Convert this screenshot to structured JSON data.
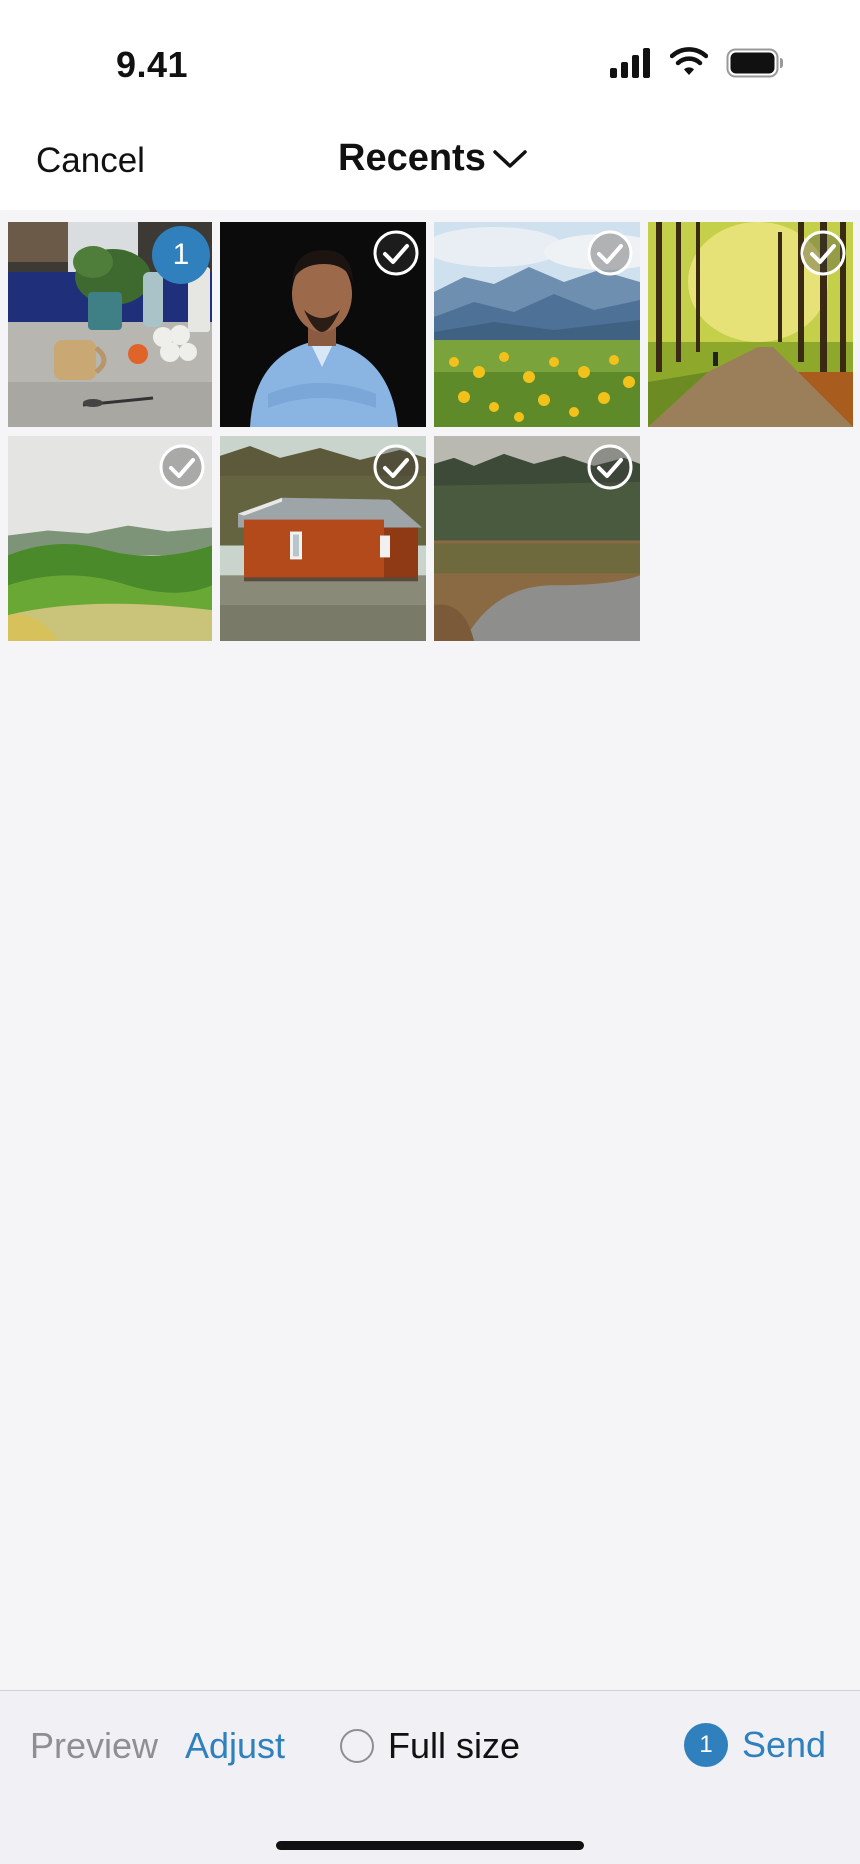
{
  "status_bar": {
    "time": "9.41",
    "icons": [
      "signal-icon",
      "wifi-icon",
      "battery-icon"
    ]
  },
  "nav": {
    "cancel_label": "Cancel",
    "album_title": "Recents",
    "album_icon": "chevron-down-icon"
  },
  "photos": [
    {
      "name": "kitchen-plant-mug",
      "selected": true,
      "selection_number": "1"
    },
    {
      "name": "man-portrait",
      "selected": false
    },
    {
      "name": "mountain-wildflowers",
      "selected": false
    },
    {
      "name": "forest-path",
      "selected": false
    },
    {
      "name": "green-hills",
      "selected": false
    },
    {
      "name": "red-cabin",
      "selected": false
    },
    {
      "name": "forest-lake",
      "selected": false
    }
  ],
  "toolbar": {
    "preview_label": "Preview",
    "adjust_label": "Adjust",
    "fullsize_label": "Full size",
    "fullsize_checked": false,
    "send_count": "1",
    "send_label": "Send"
  },
  "colors": {
    "accent": "#2f80bd",
    "disabled": "#8e8e93",
    "background": "#f5f5f7",
    "toolbar_bg": "#f0f0f5"
  }
}
